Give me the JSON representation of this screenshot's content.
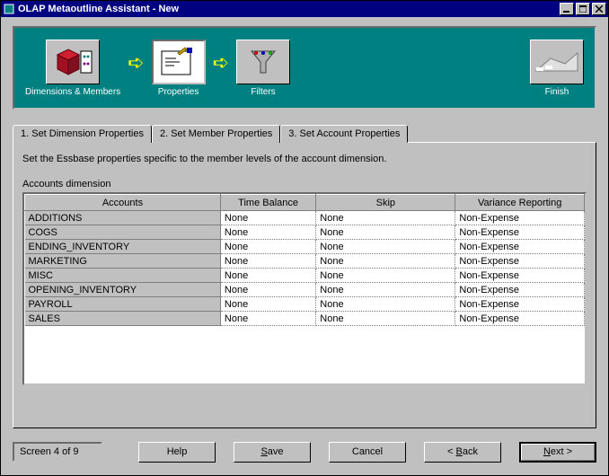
{
  "window": {
    "title": "OLAP Metaoutline Assistant - New"
  },
  "steps": {
    "dimensions": "Dimensions & Members",
    "properties": "Properties",
    "filters": "Filters",
    "finish": "Finish"
  },
  "tabs": [
    {
      "label": "1. Set Dimension Properties"
    },
    {
      "label": "2. Set Member Properties"
    },
    {
      "label": "3. Set Account Properties"
    }
  ],
  "active_tab": 2,
  "panel": {
    "instruction": "Set the Essbase properties specific to the member levels of the account dimension.",
    "group_label": "Accounts dimension",
    "columns": {
      "accounts": "Accounts",
      "time_balance": "Time Balance",
      "skip": "Skip",
      "variance_reporting": "Variance Reporting"
    },
    "rows": [
      {
        "account": "ADDITIONS",
        "time_balance": "None",
        "skip": "None",
        "variance_reporting": "Non-Expense"
      },
      {
        "account": "COGS",
        "time_balance": "None",
        "skip": "None",
        "variance_reporting": "Non-Expense"
      },
      {
        "account": "ENDING_INVENTORY",
        "time_balance": "None",
        "skip": "None",
        "variance_reporting": "Non-Expense"
      },
      {
        "account": "MARKETING",
        "time_balance": "None",
        "skip": "None",
        "variance_reporting": "Non-Expense"
      },
      {
        "account": "MISC",
        "time_balance": "None",
        "skip": "None",
        "variance_reporting": "Non-Expense"
      },
      {
        "account": "OPENING_INVENTORY",
        "time_balance": "None",
        "skip": "None",
        "variance_reporting": "Non-Expense"
      },
      {
        "account": "PAYROLL",
        "time_balance": "None",
        "skip": "None",
        "variance_reporting": "Non-Expense"
      },
      {
        "account": "SALES",
        "time_balance": "None",
        "skip": "None",
        "variance_reporting": "Non-Expense"
      }
    ]
  },
  "footer": {
    "screen_indicator": "Screen 4 of 9",
    "buttons": {
      "help": "Help",
      "save": "Save",
      "cancel": "Cancel",
      "back": "< Back",
      "next": "Next >"
    }
  }
}
